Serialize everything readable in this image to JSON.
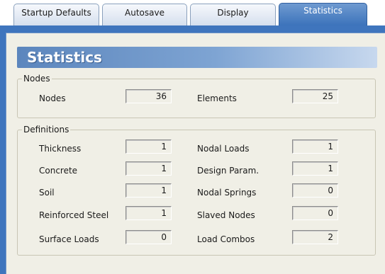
{
  "tabs": [
    {
      "label": "Startup Defaults"
    },
    {
      "label": "Autosave"
    },
    {
      "label": "Display"
    },
    {
      "label": "Statistics",
      "active": true
    }
  ],
  "header": {
    "title": "Statistics"
  },
  "nodes_group": {
    "legend": "Nodes",
    "items": [
      {
        "label": "Nodes",
        "value": "36"
      },
      {
        "label": "Elements",
        "value": "25"
      }
    ]
  },
  "definitions_group": {
    "legend": "Definitions",
    "left": [
      {
        "label": "Thickness",
        "value": "1"
      },
      {
        "label": "Concrete",
        "value": "1"
      },
      {
        "label": "Soil",
        "value": "1"
      },
      {
        "label": "Reinforced Steel",
        "value": "1"
      },
      {
        "label": "Surface Loads",
        "value": "0"
      }
    ],
    "right": [
      {
        "label": "Nodal Loads",
        "value": "1"
      },
      {
        "label": "Design Param.",
        "value": "1"
      },
      {
        "label": "Nodal Springs",
        "value": "0"
      },
      {
        "label": "Slaved Nodes",
        "value": "0"
      },
      {
        "label": "Load Combos",
        "value": "2"
      }
    ]
  },
  "colors": {
    "accent": "#3f75bd",
    "panel": "#f0efe6",
    "header": "#5c86bd"
  }
}
